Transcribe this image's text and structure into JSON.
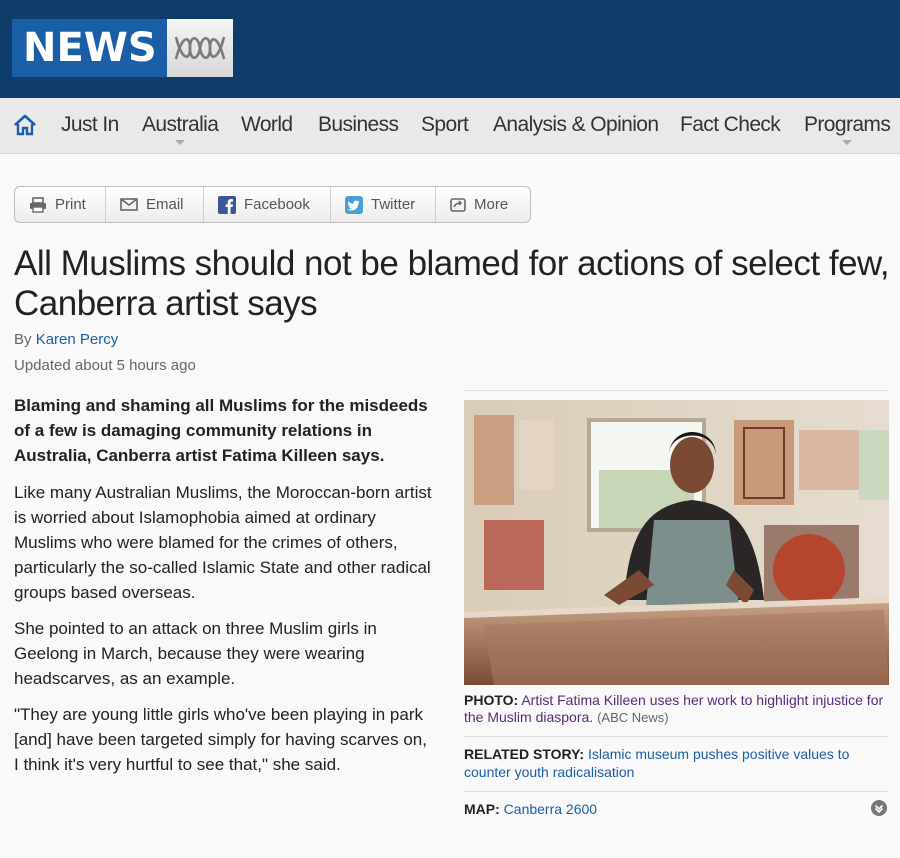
{
  "header": {
    "logo_text": "NEWS",
    "brand_mark": "abc-logo-icon"
  },
  "nav": {
    "home_icon": "home-icon",
    "items": [
      {
        "label": "Just In"
      },
      {
        "label": "Australia"
      },
      {
        "label": "World"
      },
      {
        "label": "Business"
      },
      {
        "label": "Sport"
      },
      {
        "label": "Analysis & Opinion"
      },
      {
        "label": "Fact Check"
      },
      {
        "label": "Programs"
      }
    ]
  },
  "share": {
    "print": "Print",
    "email": "Email",
    "facebook": "Facebook",
    "twitter": "Twitter",
    "more": "More"
  },
  "article": {
    "title": "All Muslims should not be blamed for actions of select few, Canberra artist says",
    "by_prefix": "By",
    "author": "Karen Percy",
    "updated": "Updated about 5 hours ago",
    "lead": "Blaming and shaming all Muslims for the misdeeds of a few is damaging community relations in Australia, Canberra artist Fatima Killeen says.",
    "paragraphs": [
      "Like many Australian Muslims, the Moroccan-born artist is worried about Islamophobia aimed at ordinary Muslims who were blamed for the crimes of others, particularly the so-called Islamic State and other radical groups based overseas.",
      "She pointed to an attack on three Muslim girls in Geelong in March, because they were wearing headscarves, as an example.",
      "\"They are young little girls who've been playing in park [and] have been targeted simply for having scarves on, I think it's very hurtful to see that,\" she said."
    ]
  },
  "sidebar": {
    "photo_label": "PHOTO:",
    "photo_caption": "Artist Fatima Killeen uses her work to highlight injustice for the Muslim diaspora.",
    "photo_source": "(ABC News)",
    "related_label": "RELATED STORY:",
    "related_link": "Islamic museum pushes positive values to counter youth radicalisation",
    "map_label": "MAP:",
    "map_link": "Canberra 2600"
  },
  "colors": {
    "header_bg": "#0e3d6b",
    "logo_bg": "#1a5ea8",
    "link": "#1a5ea8",
    "nav_bg": "#e9e9e9"
  }
}
